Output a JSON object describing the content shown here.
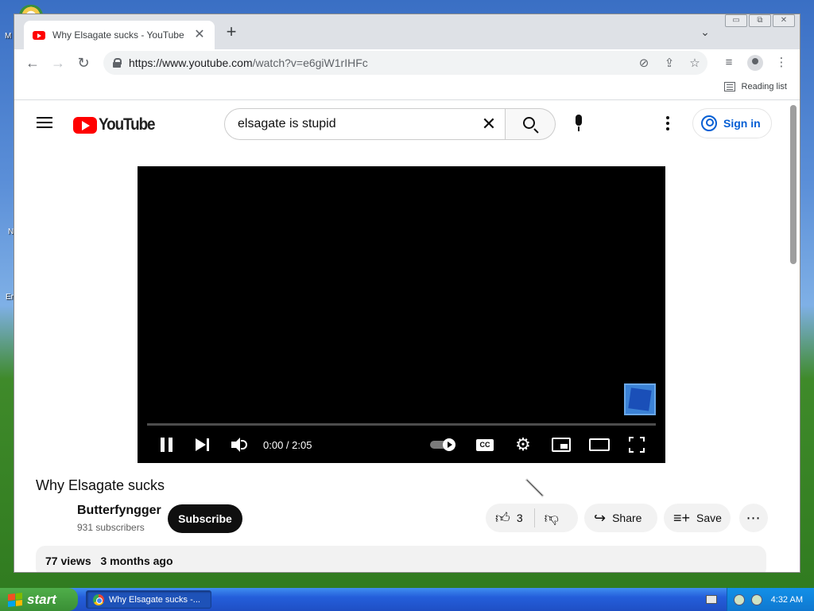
{
  "browser": {
    "tab_title": "Why Elsagate sucks - YouTube",
    "new_tab": "+",
    "url_host": "https://www.youtube.com",
    "url_path": "/watch?v=e6giW1rIHFc",
    "reading_list": "Reading list"
  },
  "youtube": {
    "logo_text": "YouTube",
    "search_query": "elsagate is stupid",
    "sign_in": "Sign in",
    "player": {
      "time": "0:00 / 2:05",
      "cc": "CC"
    },
    "video": {
      "title": "Why Elsagate sucks",
      "channel": "Butterfyngger",
      "subscribers": "931 subscribers",
      "subscribe": "Subscribe",
      "likes": "3",
      "share": "Share",
      "save": "Save",
      "views": "77 views",
      "age": "3 months ago"
    }
  },
  "taskbar": {
    "start": "start",
    "task_title": "Why Elsagate sucks -...",
    "clock": "4:32 AM"
  },
  "desktop": {
    "labels": [
      "M",
      "N",
      "Er"
    ]
  },
  "colors": {
    "youtube_red": "#ff0000",
    "link_blue": "#065fd4",
    "xp_blue": "#245edb",
    "xp_green": "#3a8f35"
  }
}
